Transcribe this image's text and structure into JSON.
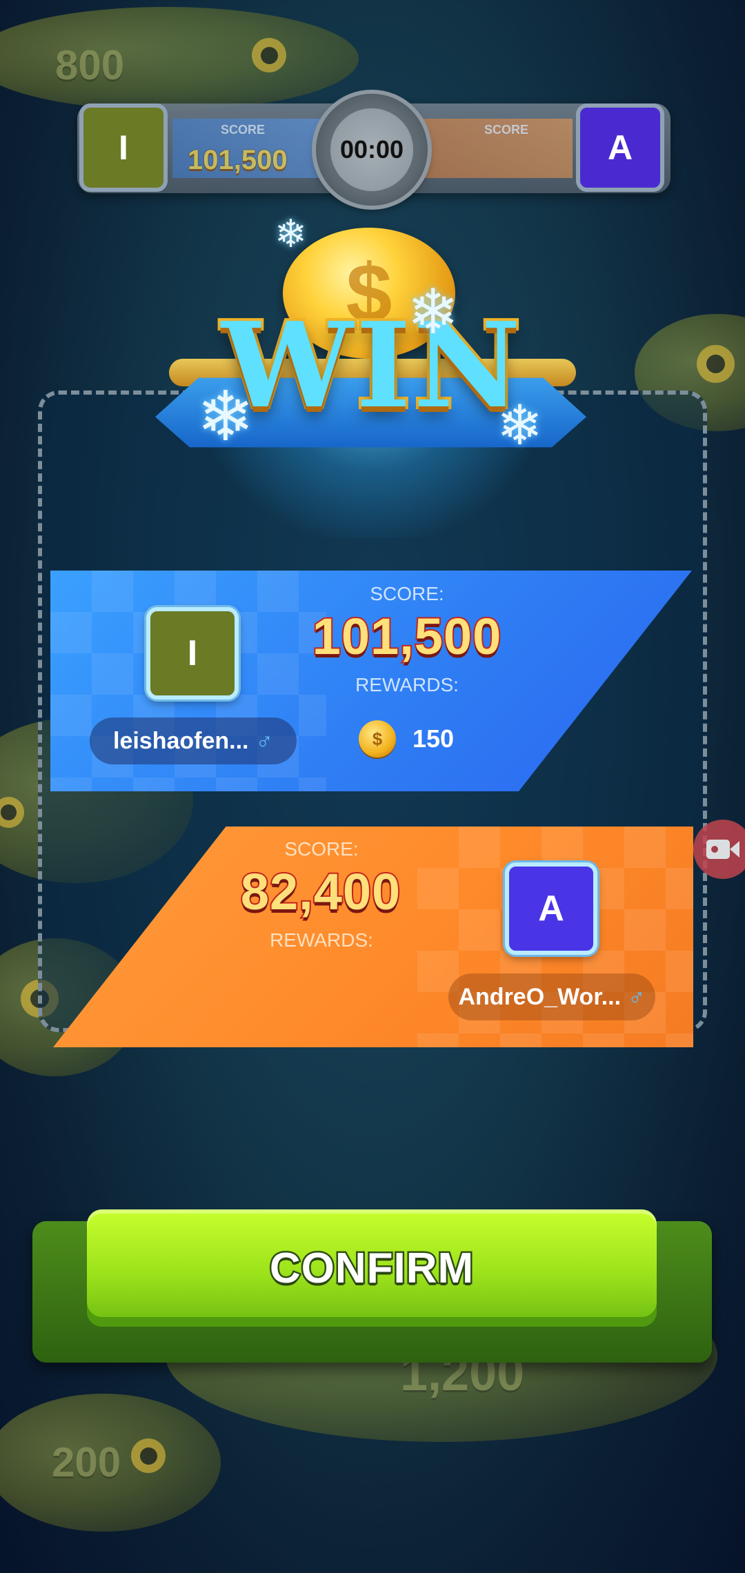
{
  "background": {
    "numbers": [
      "800",
      "1,200",
      "200"
    ]
  },
  "topbar": {
    "left_player": {
      "initial": "I",
      "color": "#6b7a25",
      "score_label": "SCORE",
      "score": "101,500"
    },
    "right_player": {
      "initial": "A",
      "color": "#4a2ad0",
      "score_label": "SCORE",
      "score": ""
    },
    "timer": "00:00"
  },
  "result": {
    "banner": "WIN",
    "winner": {
      "initial": "I",
      "avatar_color": "#6b7a25",
      "name": "leishaofen...",
      "gender_icon": "male-icon",
      "score_label": "SCORE:",
      "score": "101,500",
      "rewards_label": "REWARDS:",
      "reward_icon": "coin-icon",
      "reward_amount": "150"
    },
    "loser": {
      "initial": "A",
      "avatar_color": "#4a35e6",
      "name": "AndreO_Wor...",
      "gender_icon": "male-icon",
      "score_label": "SCORE:",
      "score": "82,400",
      "rewards_label": "REWARDS:"
    }
  },
  "confirm_label": "CONFIRM",
  "record_icon": "video-record-icon"
}
